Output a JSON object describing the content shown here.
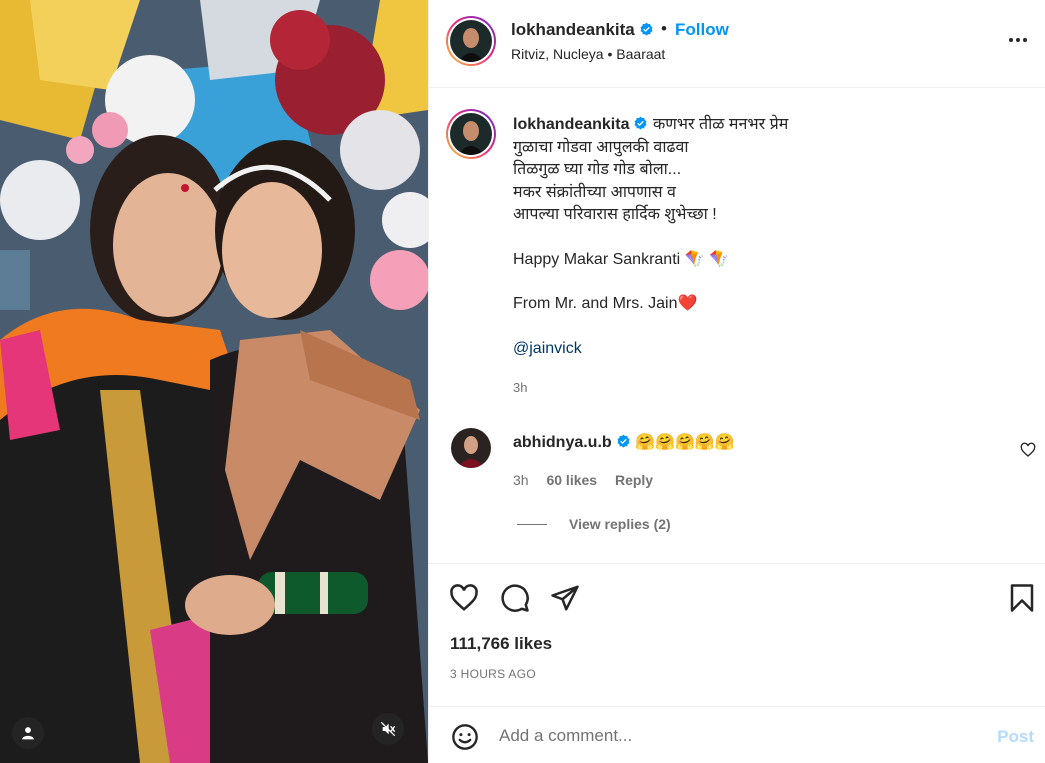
{
  "header": {
    "username": "lokhandeankita",
    "separator": "•",
    "follow_label": "Follow",
    "audio_artists": "Ritviz, Nucleya",
    "audio_dot": "•",
    "audio_title": "Baaraat"
  },
  "caption": {
    "username": "lokhandeankita",
    "line1": "कणभर तीळ मनभर प्रेम",
    "line2": "गुळाचा गोडवा आपुलकी वाढवा",
    "line3": "तिळगुळ घ्या गोड गोड बोला...",
    "line4": "मकर संक्रांतीच्या आपणास व",
    "line5": "आपल्या परिवारास हार्दिक शुभेच्छा !",
    "line6": "Happy Makar Sankranti 🪁 🪁",
    "line7": "From Mr. and Mrs. Jain❤️",
    "mention": "@jainvick",
    "time": "3h"
  },
  "comment": {
    "username": "abhidnya.u.b",
    "text": "🤗🤗🤗🤗🤗",
    "time": "3h",
    "likes": "60 likes",
    "reply_label": "Reply",
    "view_replies": "View replies (2)"
  },
  "post": {
    "likes": "111,766 likes",
    "time_ago": "3 HOURS AGO"
  },
  "add_comment": {
    "placeholder": "Add a comment...",
    "post_label": "Post"
  },
  "colors": {
    "accent": "#0095f6",
    "muted": "#737373",
    "post_disabled": "#b3dbff",
    "verified": "#0095f6"
  },
  "icons": [
    "user-tag-icon",
    "mute-icon",
    "verified-icon",
    "more-icon",
    "heart-icon",
    "comment-icon",
    "share-icon",
    "bookmark-icon",
    "emoji-icon"
  ]
}
